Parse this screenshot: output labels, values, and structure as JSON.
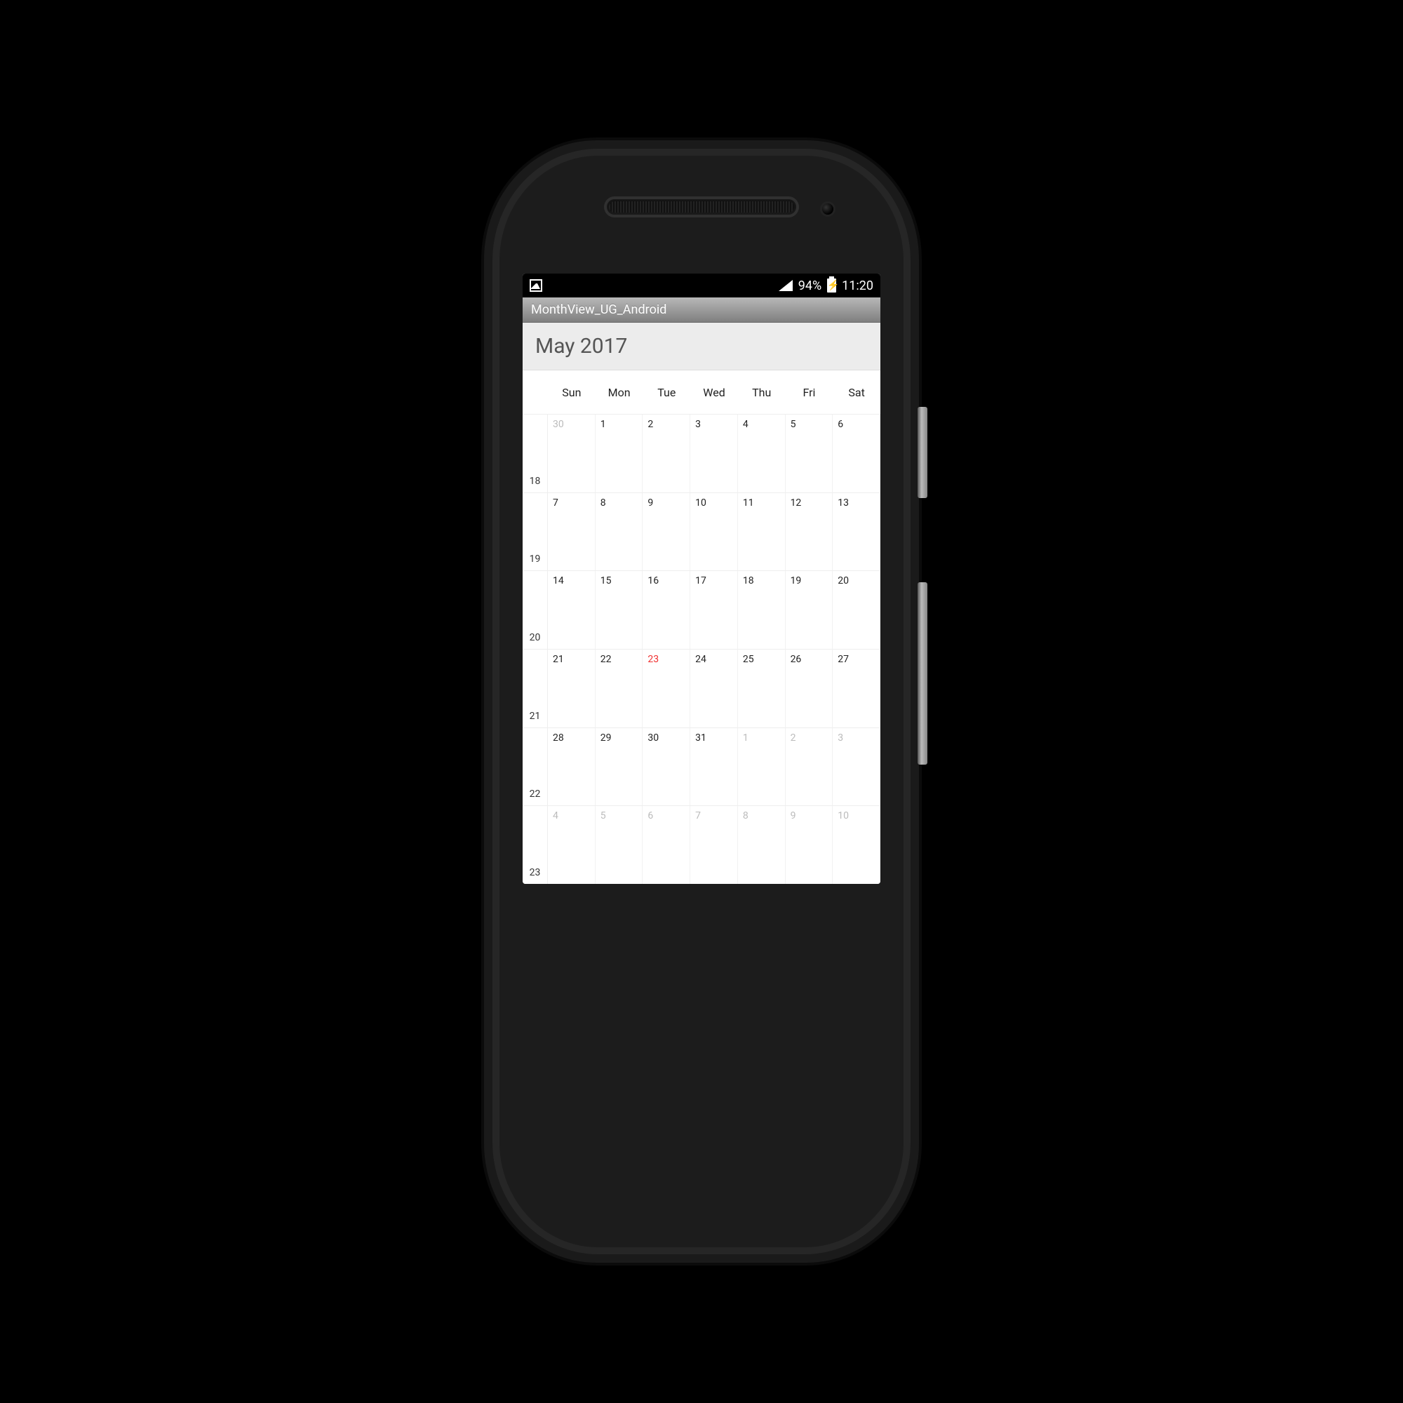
{
  "statusbar": {
    "battery_percent": "94%",
    "clock": "11:20"
  },
  "appbar": {
    "title": "MonthView_UG_Android"
  },
  "calendar": {
    "month_title": "May 2017",
    "day_headers": [
      "Sun",
      "Mon",
      "Tue",
      "Wed",
      "Thu",
      "Fri",
      "Sat"
    ],
    "weeks": [
      {
        "weeknum": "18",
        "days": [
          {
            "n": "30",
            "out": true
          },
          {
            "n": "1"
          },
          {
            "n": "2"
          },
          {
            "n": "3"
          },
          {
            "n": "4"
          },
          {
            "n": "5"
          },
          {
            "n": "6"
          }
        ]
      },
      {
        "weeknum": "19",
        "days": [
          {
            "n": "7"
          },
          {
            "n": "8"
          },
          {
            "n": "9"
          },
          {
            "n": "10"
          },
          {
            "n": "11"
          },
          {
            "n": "12"
          },
          {
            "n": "13"
          }
        ]
      },
      {
        "weeknum": "20",
        "days": [
          {
            "n": "14"
          },
          {
            "n": "15"
          },
          {
            "n": "16"
          },
          {
            "n": "17"
          },
          {
            "n": "18"
          },
          {
            "n": "19"
          },
          {
            "n": "20"
          }
        ]
      },
      {
        "weeknum": "21",
        "days": [
          {
            "n": "21"
          },
          {
            "n": "22"
          },
          {
            "n": "23",
            "today": true
          },
          {
            "n": "24"
          },
          {
            "n": "25"
          },
          {
            "n": "26"
          },
          {
            "n": "27"
          }
        ]
      },
      {
        "weeknum": "22",
        "days": [
          {
            "n": "28"
          },
          {
            "n": "29"
          },
          {
            "n": "30"
          },
          {
            "n": "31"
          },
          {
            "n": "1",
            "out": true
          },
          {
            "n": "2",
            "out": true
          },
          {
            "n": "3",
            "out": true
          }
        ]
      },
      {
        "weeknum": "23",
        "days": [
          {
            "n": "4",
            "out": true
          },
          {
            "n": "5",
            "out": true
          },
          {
            "n": "6",
            "out": true
          },
          {
            "n": "7",
            "out": true
          },
          {
            "n": "8",
            "out": true
          },
          {
            "n": "9",
            "out": true
          },
          {
            "n": "10",
            "out": true
          }
        ]
      }
    ]
  }
}
